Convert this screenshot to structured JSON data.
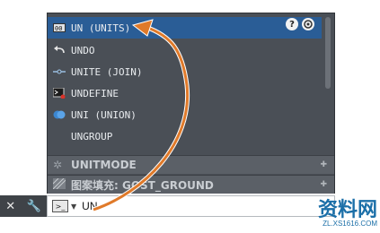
{
  "suggestions": [
    {
      "label": "UN (UNITS)",
      "icon": "units-icon",
      "selected": true
    },
    {
      "label": "UNDO",
      "icon": "undo-arrow-icon",
      "selected": false
    },
    {
      "label": "UNITE (JOIN)",
      "icon": "join-icon",
      "selected": false
    },
    {
      "label": "UNDEFINE",
      "icon": "undefine-icon",
      "selected": false
    },
    {
      "label": "UNI (UNION)",
      "icon": "union-icon",
      "selected": false
    },
    {
      "label": "UNGROUP",
      "icon": "",
      "selected": false
    }
  ],
  "sections": [
    {
      "label": "UNITMODE",
      "icon": "gear-icon"
    },
    {
      "label": "图案填充: GOST_GROUND",
      "icon": "hatch-icon"
    }
  ],
  "help_icon_glyph": "?",
  "command_line": {
    "input_value": "UN",
    "prompt_glyph": ">_"
  },
  "watermark": {
    "logo": "资料网",
    "url": "ZL.XS1616.COM"
  },
  "colors": {
    "panel_bg": "#4a4f56",
    "selected_bg": "#2a5d96",
    "arrow": "#e07a2a"
  }
}
